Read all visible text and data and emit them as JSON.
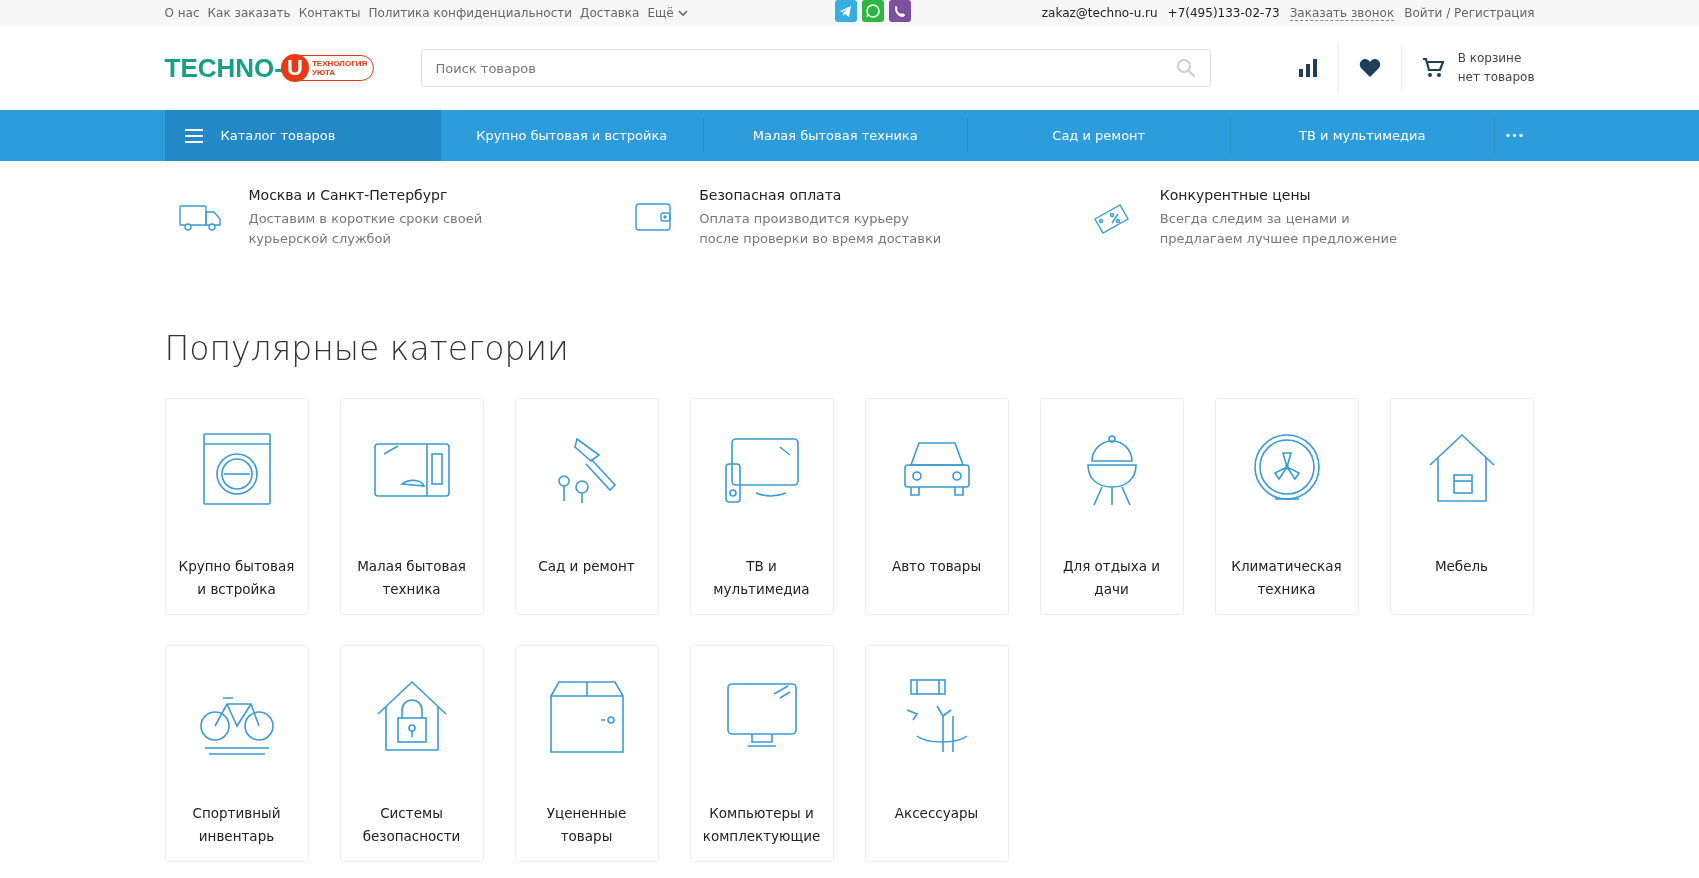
{
  "top_links": [
    "О нас",
    "Как заказать",
    "Контакты",
    "Политика конфиденциальности",
    "Доставка"
  ],
  "more_link": "Ещё",
  "contacts": {
    "email": "zakaz@techno-u.ru",
    "phone": "+7(495)133-02-73",
    "callback": "Заказать звонок",
    "login": "Войти / Регистрация"
  },
  "logo": {
    "name": "TECHNO-",
    "letter": "U",
    "tagline_1": "ТЕХНОЛОГИЯ",
    "tagline_2": "УЮТА"
  },
  "search": {
    "placeholder": "Поиск товаров"
  },
  "cart": {
    "line_1": "В корзине",
    "line_2": "нет товаров"
  },
  "nav": {
    "catalog": "Каталог товаров",
    "items": [
      "Крупно бытовая и встройка",
      "Малая бытовая техника",
      "Сад и ремонт",
      "ТВ и мультимедиа"
    ],
    "more": "•••"
  },
  "features": [
    {
      "title": "Москва и Санкт-Петербург",
      "text": "Доставим в короткие сроки своей курьерской службой"
    },
    {
      "title": "Безопасная оплата",
      "text": "Оплата производится курьеру после проверки во время доставки"
    },
    {
      "title": "Конкурентные цены",
      "text": "Всегда следим за ценами и предлагаем лучшее предложение"
    }
  ],
  "section_title": "Популярные категории",
  "categories": [
    {
      "label": "Крупно бытовая и встройка"
    },
    {
      "label": "Малая бытовая техника"
    },
    {
      "label": "Сад и ремонт"
    },
    {
      "label": "ТВ и мультимедиа"
    },
    {
      "label": "Авто товары"
    },
    {
      "label": "Для отдыха и дачи"
    },
    {
      "label": "Климатическая техника"
    },
    {
      "label": "Мебель"
    },
    {
      "label": "Спортивный инвентарь"
    },
    {
      "label": "Системы безопасности"
    },
    {
      "label": "Уцененные товары"
    },
    {
      "label": "Компьютеры и комплектующие"
    },
    {
      "label": "Аксессуары"
    }
  ]
}
